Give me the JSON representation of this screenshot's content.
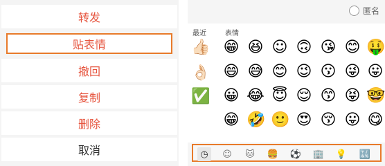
{
  "menu": {
    "items": [
      {
        "label": "转发"
      },
      {
        "label": "贴表情"
      },
      {
        "label": "撤回"
      },
      {
        "label": "复制"
      },
      {
        "label": "删除"
      },
      {
        "label": "取消"
      }
    ]
  },
  "emoji_panel": {
    "anonymous_label": "匿名",
    "recent_label": "最近",
    "emoji_label": "表情",
    "recent": [
      {
        "icon": "thumbs-up-icon",
        "glyph": "👍🏻"
      },
      {
        "icon": "ok-hand-icon",
        "glyph": "👌🏻"
      },
      {
        "icon": "check-mark-button-icon",
        "glyph": "✅"
      }
    ],
    "emojis": [
      [
        "😁",
        "😆",
        "☺",
        "🙃",
        "😘",
        "😊",
        "🤑"
      ],
      [
        "😄",
        "😅",
        "😊",
        "😉",
        "😗",
        "😜",
        "😛"
      ],
      [
        "😀",
        "😂",
        "😇",
        "😌",
        "😙",
        "😝",
        "🤓"
      ],
      [
        "😁",
        "🤣",
        "🙂",
        "😍",
        "😚",
        "😛",
        "😋"
      ]
    ],
    "tabs": [
      {
        "icon": "clock-icon",
        "glyph": "◷"
      },
      {
        "icon": "smiley-icon",
        "glyph": "☺"
      },
      {
        "icon": "cat-face-icon",
        "glyph": "🐱"
      },
      {
        "icon": "burger-icon",
        "glyph": "🍔"
      },
      {
        "icon": "soccer-ball-icon",
        "glyph": "⚽"
      },
      {
        "icon": "building-icon",
        "glyph": "🏢"
      },
      {
        "icon": "light-bulb-icon",
        "glyph": "💡"
      },
      {
        "icon": "symbols-icon",
        "glyph": "🔣"
      }
    ]
  }
}
